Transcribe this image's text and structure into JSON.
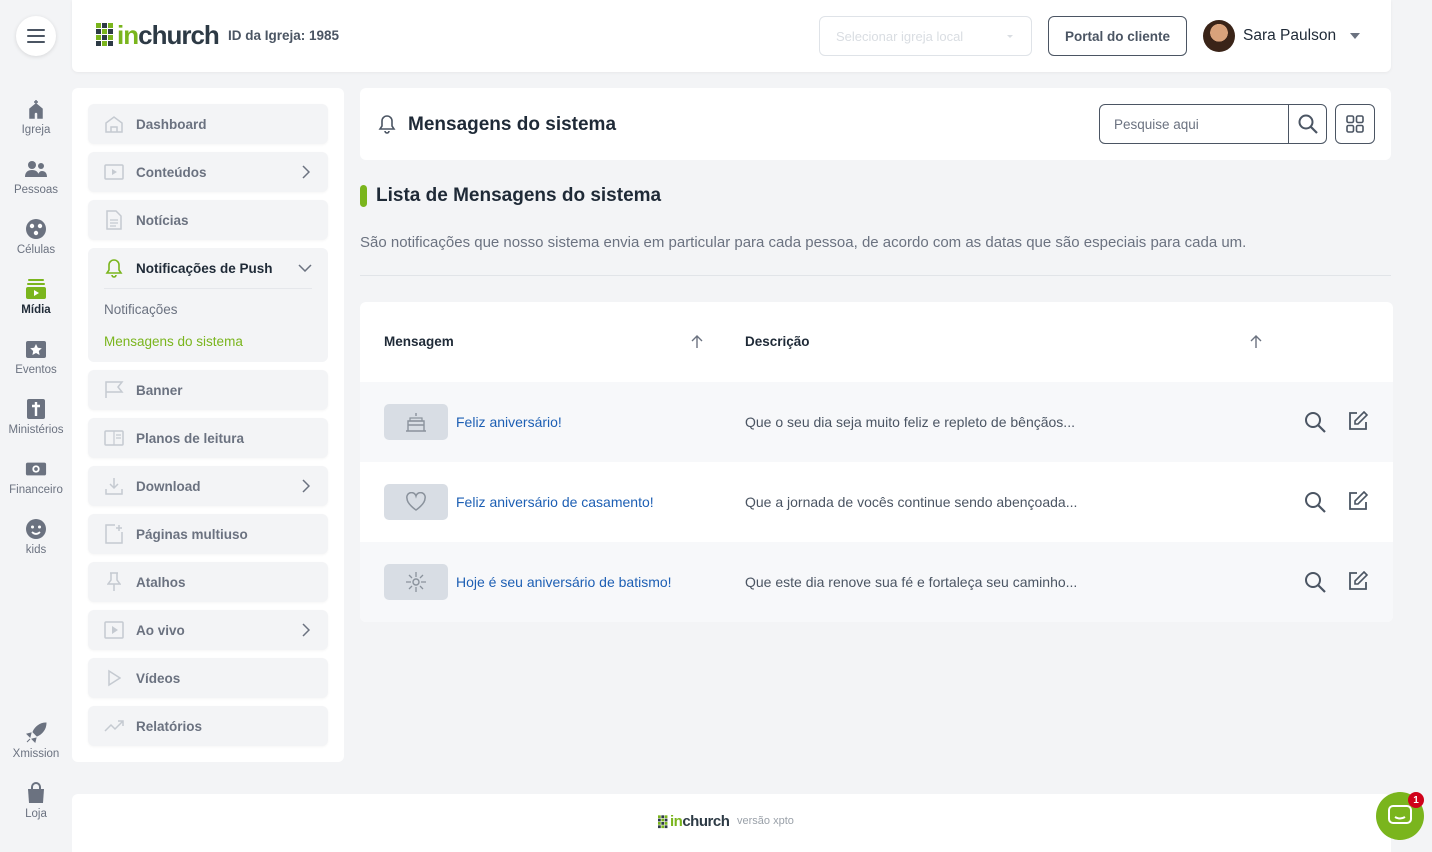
{
  "brand": {
    "logo_prefix": "in",
    "logo_suffix": "church",
    "accent": "#7ab51d"
  },
  "header": {
    "church_id": "ID da Igreja: 1985",
    "select_placeholder": "Selecionar igreja local",
    "portal_button": "Portal do cliente",
    "user_name": "Sara Paulson"
  },
  "rail": {
    "items": [
      {
        "label": "Igreja",
        "icon": "church-icon"
      },
      {
        "label": "Pessoas",
        "icon": "people-icon"
      },
      {
        "label": "Células",
        "icon": "cells-icon"
      },
      {
        "label": "Mídia",
        "icon": "media-icon",
        "active": true
      },
      {
        "label": "Eventos",
        "icon": "events-icon"
      },
      {
        "label": "Ministérios",
        "icon": "ministries-icon"
      },
      {
        "label": "Financeiro",
        "icon": "finance-icon"
      },
      {
        "label": "kids",
        "icon": "kids-icon"
      },
      {
        "label": "Xmission",
        "icon": "rocket-icon"
      },
      {
        "label": "Loja",
        "icon": "shopping-bag-icon"
      }
    ]
  },
  "sidebar": {
    "items": [
      {
        "label": "Dashboard",
        "icon": "home-icon"
      },
      {
        "label": "Conteúdos",
        "icon": "content-icon",
        "has_submenu": true
      },
      {
        "label": "Notícias",
        "icon": "news-icon"
      },
      {
        "label": "Notificações de Push",
        "icon": "bell-icon",
        "expanded": true
      },
      {
        "label": "Banner",
        "icon": "flag-icon"
      },
      {
        "label": "Planos de leitura",
        "icon": "book-icon"
      },
      {
        "label": "Download",
        "icon": "download-icon",
        "has_submenu": true
      },
      {
        "label": "Páginas multiuso",
        "icon": "page-add-icon"
      },
      {
        "label": "Atalhos",
        "icon": "pin-icon"
      },
      {
        "label": "Ao vivo",
        "icon": "live-icon",
        "has_submenu": true
      },
      {
        "label": "Vídeos",
        "icon": "play-icon"
      },
      {
        "label": "Relatórios",
        "icon": "chart-icon"
      }
    ],
    "push_subitems": [
      {
        "label": "Notificações"
      },
      {
        "label": "Mensagens do sistema",
        "active": true
      }
    ]
  },
  "page": {
    "title": "Mensagens do sistema",
    "search_placeholder": "Pesquise aqui",
    "list_title": "Lista de Mensagens do sistema",
    "list_description": "São notificações que nosso sistema envia em particular para cada pessoa, de acordo com as datas que são especiais para cada um."
  },
  "table": {
    "columns": [
      "Mensagem",
      "Descrição"
    ],
    "rows": [
      {
        "icon": "cake-icon",
        "message": "Feliz aniversário!",
        "description": "Que o seu dia seja muito feliz e repleto de bênçãos..."
      },
      {
        "icon": "heart-icon",
        "message": "Feliz aniversário de casamento!",
        "description": "Que a jornada de vocês continue sendo abençoada..."
      },
      {
        "icon": "sparkle-icon",
        "message": "Hoje é seu aniversário de batismo!",
        "description": "Que este dia renove sua fé e fortaleça seu caminho..."
      }
    ]
  },
  "footer": {
    "version": "versão xpto"
  },
  "chat": {
    "badge_count": "1"
  }
}
